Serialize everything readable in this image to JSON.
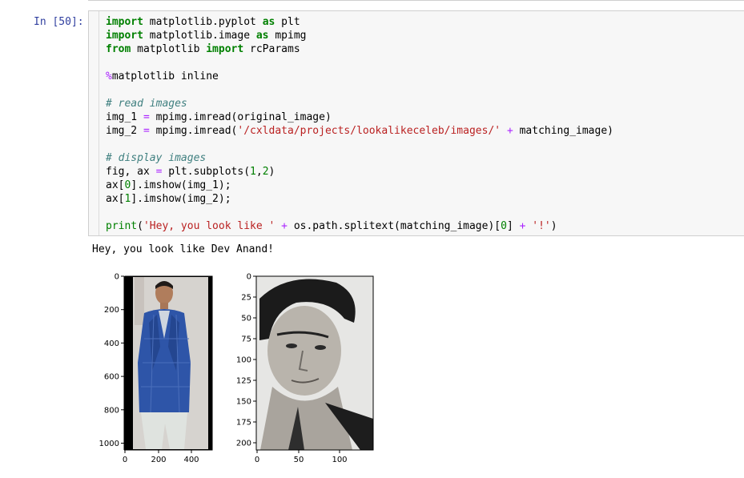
{
  "cell": {
    "prompt": "In [50]:",
    "lines": [
      [
        {
          "t": "import",
          "c": "kw"
        },
        {
          "t": " matplotlib.pyplot "
        },
        {
          "t": "as",
          "c": "kw"
        },
        {
          "t": " plt"
        }
      ],
      [
        {
          "t": "import",
          "c": "kw"
        },
        {
          "t": " matplotlib.image "
        },
        {
          "t": "as",
          "c": "kw"
        },
        {
          "t": " mpimg"
        }
      ],
      [
        {
          "t": "from",
          "c": "kw"
        },
        {
          "t": " matplotlib "
        },
        {
          "t": "import",
          "c": "kw"
        },
        {
          "t": " rcParams"
        }
      ],
      [],
      [
        {
          "t": "%",
          "c": "magic"
        },
        {
          "t": "matplotlib inline"
        }
      ],
      [],
      [
        {
          "t": "# read images",
          "c": "cmt"
        }
      ],
      [
        {
          "t": "img_1 "
        },
        {
          "t": "=",
          "c": "op"
        },
        {
          "t": " mpimg.imread(original_image)"
        }
      ],
      [
        {
          "t": "img_2 "
        },
        {
          "t": "=",
          "c": "op"
        },
        {
          "t": " mpimg.imread("
        },
        {
          "t": "'/cxldata/projects/lookalikeceleb/images/'",
          "c": "str"
        },
        {
          "t": " "
        },
        {
          "t": "+",
          "c": "op"
        },
        {
          "t": " matching_image)"
        }
      ],
      [],
      [
        {
          "t": "# display images",
          "c": "cmt"
        }
      ],
      [
        {
          "t": "fig, ax "
        },
        {
          "t": "=",
          "c": "op"
        },
        {
          "t": " plt.subplots("
        },
        {
          "t": "1",
          "c": "num"
        },
        {
          "t": ","
        },
        {
          "t": "2",
          "c": "num"
        },
        {
          "t": ")"
        }
      ],
      [
        {
          "t": "ax["
        },
        {
          "t": "0",
          "c": "num"
        },
        {
          "t": "].imshow(img_1);"
        }
      ],
      [
        {
          "t": "ax["
        },
        {
          "t": "1",
          "c": "num"
        },
        {
          "t": "].imshow(img_2);"
        }
      ],
      [],
      [
        {
          "t": "print",
          "c": "fn"
        },
        {
          "t": "("
        },
        {
          "t": "'Hey, you look like '",
          "c": "str"
        },
        {
          "t": " "
        },
        {
          "t": "+",
          "c": "op"
        },
        {
          "t": " os.path.splitext(matching_image)["
        },
        {
          "t": "0",
          "c": "num"
        },
        {
          "t": "] "
        },
        {
          "t": "+",
          "c": "op"
        },
        {
          "t": " "
        },
        {
          "t": "'!'",
          "c": "str"
        },
        {
          "t": ")"
        }
      ]
    ]
  },
  "output": {
    "text": "Hey, you look like Dev Anand!"
  },
  "figure": {
    "left_axes": {
      "yticks": [
        "0",
        "200",
        "400",
        "600",
        "800",
        "1000"
      ],
      "xticks": [
        "0",
        "200",
        "400"
      ]
    },
    "right_axes": {
      "yticks": [
        "0",
        "25",
        "50",
        "75",
        "100",
        "125",
        "150",
        "175",
        "200"
      ],
      "xticks": [
        "0",
        "50",
        "100"
      ]
    }
  },
  "colors": {
    "prompt": "#303f9f",
    "cell_bg": "#f7f7f7",
    "keyword": "#008000",
    "string": "#ba2121",
    "comment": "#408080",
    "operator": "#aa22ff"
  }
}
